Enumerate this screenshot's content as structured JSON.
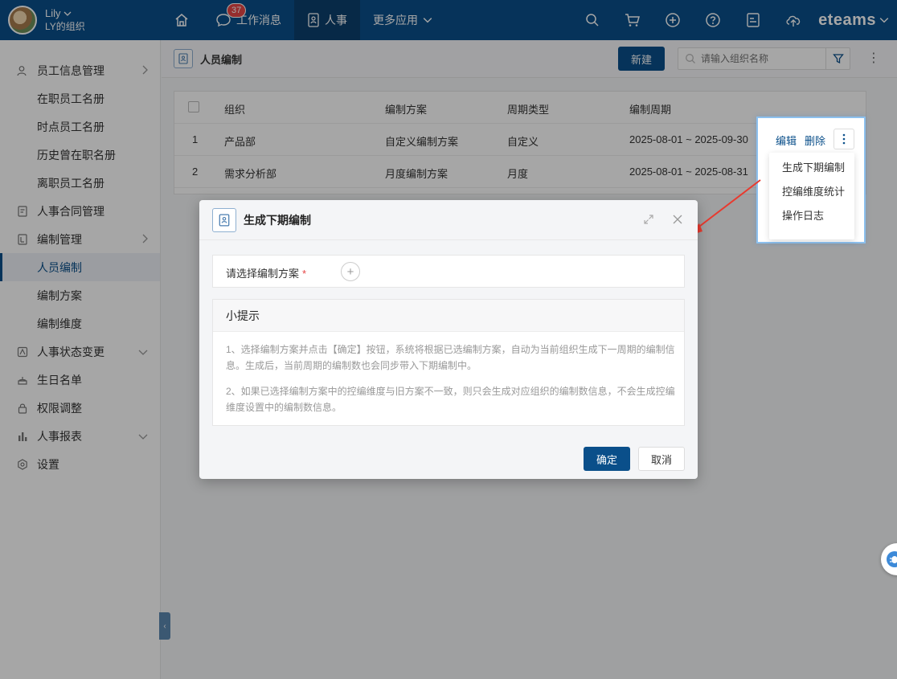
{
  "header": {
    "user_name": "Lily",
    "user_org": "LY的组织",
    "badge_count": "37",
    "nav": [
      {
        "label": ""
      },
      {
        "label": "工作消息"
      },
      {
        "label": "人事"
      },
      {
        "label": "更多应用"
      }
    ],
    "brand": "eteams"
  },
  "sidebar": {
    "items": [
      {
        "label": "员工信息管理"
      },
      {
        "label": "在职员工名册"
      },
      {
        "label": "时点员工名册"
      },
      {
        "label": "历史曾在职名册"
      },
      {
        "label": "离职员工名册"
      },
      {
        "label": "人事合同管理"
      },
      {
        "label": "编制管理"
      },
      {
        "label": "人员编制"
      },
      {
        "label": "编制方案"
      },
      {
        "label": "编制维度"
      },
      {
        "label": "人事状态变更"
      },
      {
        "label": "生日名单"
      },
      {
        "label": "权限调整"
      },
      {
        "label": "人事报表"
      },
      {
        "label": "设置"
      }
    ]
  },
  "page": {
    "title": "人员编制",
    "new_label": "新建",
    "search_placeholder": "请输入组织名称"
  },
  "table": {
    "columns": [
      "组织",
      "编制方案",
      "周期类型",
      "编制周期"
    ],
    "rows": [
      {
        "index": "1",
        "org": "产品部",
        "plan": "自定义编制方案",
        "cycle_type": "自定义",
        "period": "2025-08-01 ~ 2025-09-30"
      },
      {
        "index": "2",
        "org": "需求分析部",
        "plan": "月度编制方案",
        "cycle_type": "月度",
        "period": "2025-08-01 ~ 2025-08-31"
      }
    ]
  },
  "actions": {
    "edit": "编辑",
    "delete": "删除",
    "menu": [
      "生成下期编制",
      "控编维度统计",
      "操作日志"
    ]
  },
  "modal": {
    "title": "生成下期编制",
    "field_label": "请选择编制方案",
    "required_mark": "*",
    "tips_title": "小提示",
    "tip1": "1、选择编制方案并点击【确定】按钮，系统将根据已选编制方案，自动为当前组织生成下一周期的编制信息。生成后，当前周期的编制数也会同步带入下期编制中。",
    "tip2": "2、如果已选择编制方案中的控编维度与旧方案不一致，则只会生成对应组织的编制数信息，不会生成控编维度设置中的编制数信息。",
    "ok": "确定",
    "cancel": "取消"
  },
  "colors": {
    "primary": "#0a4f8a",
    "badge": "#e64545",
    "highlight": "#8cc0ee",
    "arrow": "#e83a2f"
  }
}
